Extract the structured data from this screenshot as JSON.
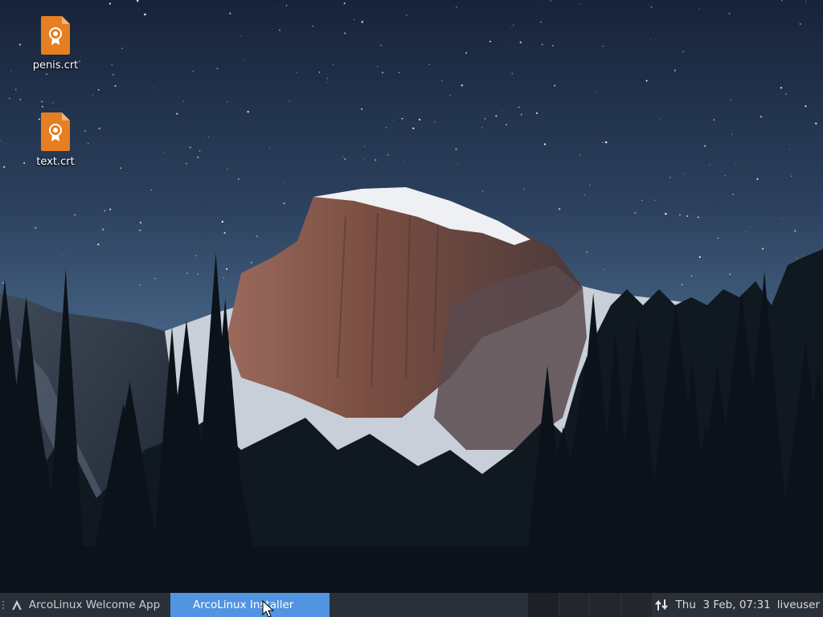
{
  "desktop": {
    "wallpaper": "night-sky-mountain-half-dome",
    "icons": [
      {
        "label": "penis.crt",
        "icon": "certificate-file-icon"
      },
      {
        "label": "text.crt",
        "icon": "certificate-file-icon"
      }
    ]
  },
  "taskbar": {
    "tasks": [
      {
        "label": "ArcoLinux Welcome App",
        "icon": "arcolinux-logo-icon",
        "active": false
      },
      {
        "label": "ArcoLinux Installer",
        "active": true
      }
    ],
    "workspaces": 4,
    "tray": {
      "network_icon": "network-updown-arrows-icon",
      "clock": "Thu  3 Feb, 07:31",
      "user": "liveuser"
    }
  },
  "colors": {
    "taskbar_bg": "#2b2f38",
    "active_task_bg": "#5294e2",
    "file_icon_orange": "#e67e22"
  }
}
